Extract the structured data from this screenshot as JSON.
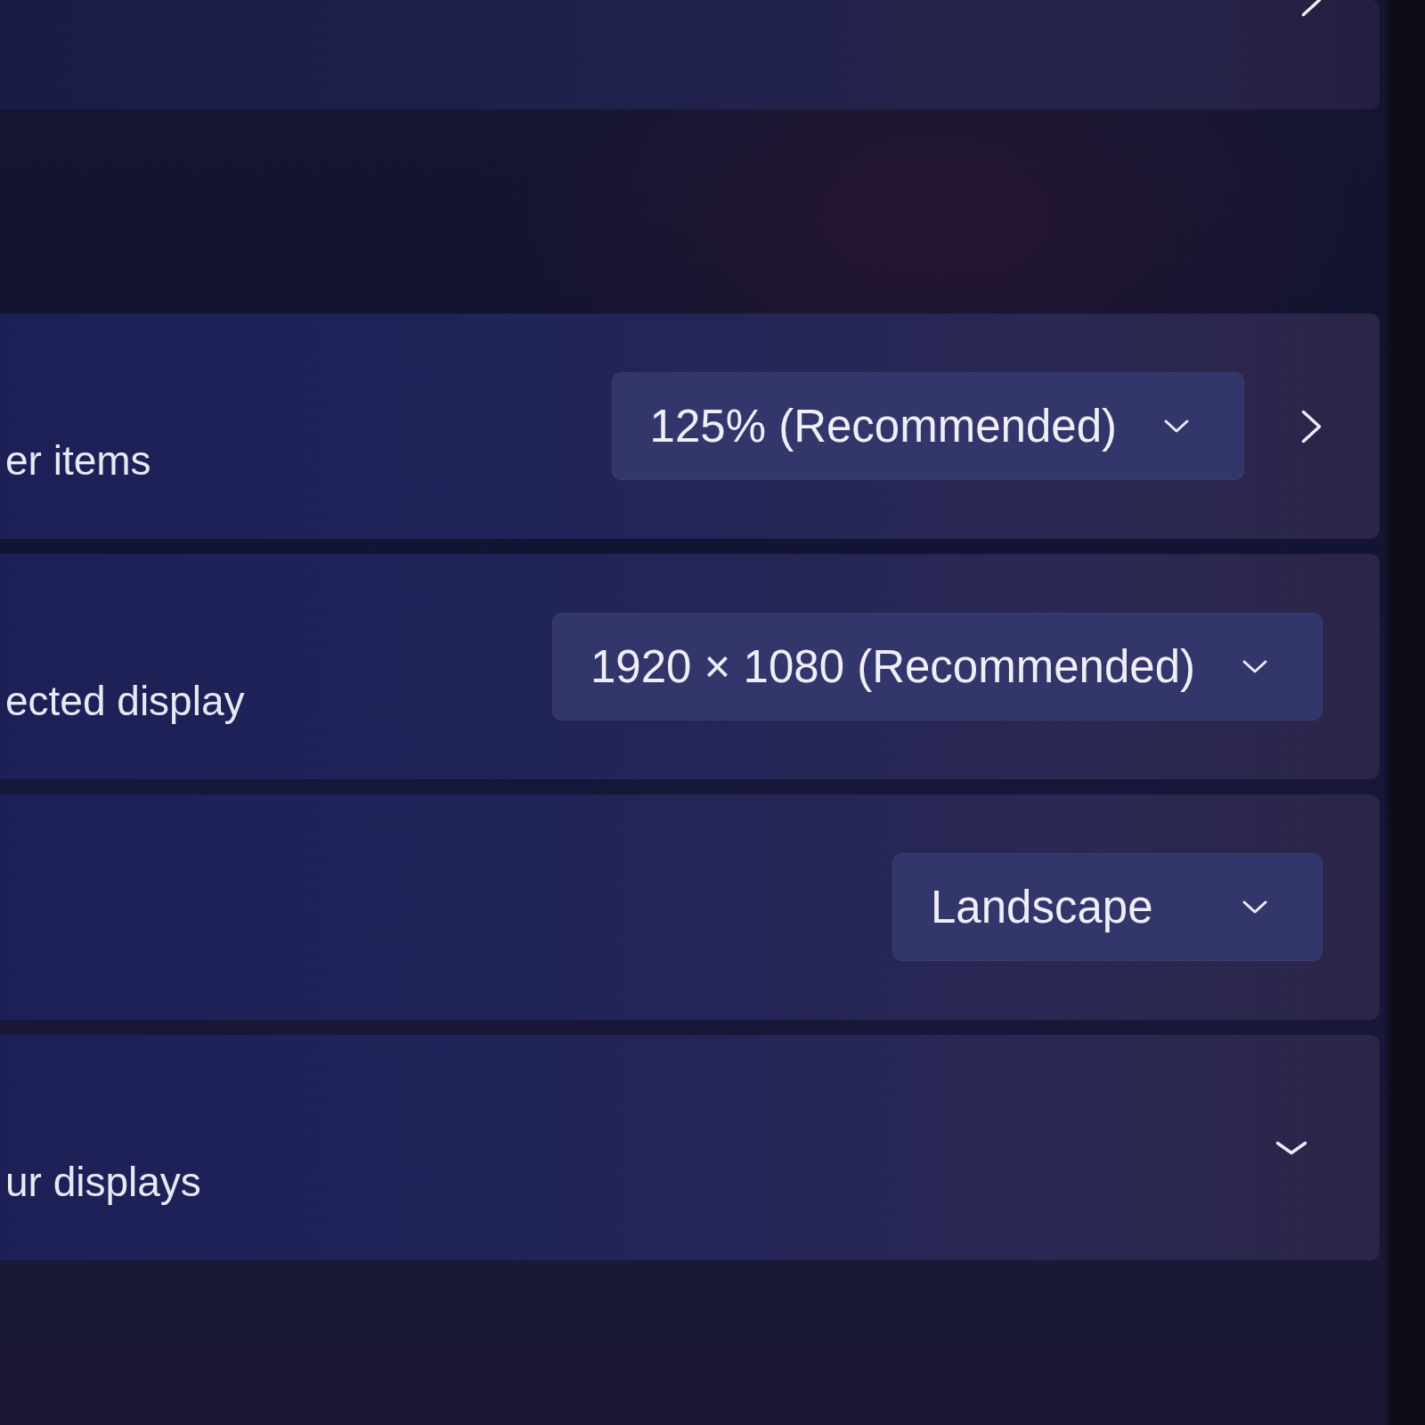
{
  "sections": [
    {
      "cards": [
        {
          "kind": "link"
        }
      ]
    },
    {
      "cards": [
        {
          "kind": "dropdown_link",
          "description": "er items",
          "dropdown": {
            "value": "125% (Recommended)"
          }
        },
        {
          "kind": "dropdown",
          "description": "ected display",
          "dropdown": {
            "value": "1920 × 1080 (Recommended)"
          }
        },
        {
          "kind": "dropdown",
          "dropdown": {
            "value": "Landscape"
          }
        },
        {
          "kind": "expander",
          "description": "ur displays",
          "expanded": false
        }
      ]
    }
  ]
}
